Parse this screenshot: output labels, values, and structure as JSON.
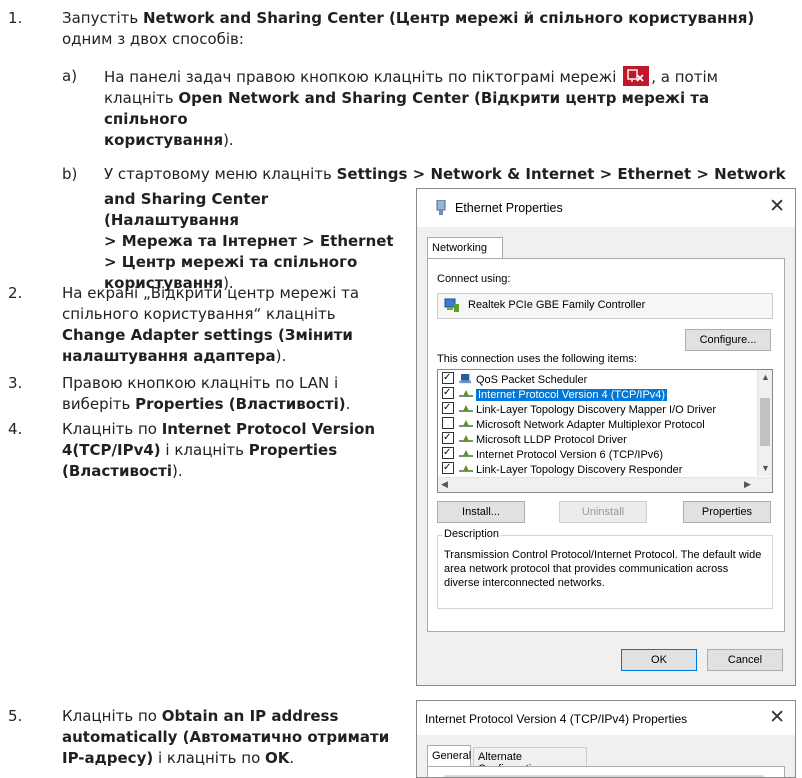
{
  "steps": [
    {
      "num": "1.",
      "pre": "Запустіть ",
      "bold": "Network and Sharing Center (Центр мережі й спільного користування)",
      "line2": "одним з двох способів:"
    },
    {
      "num": "2.",
      "l1": "На екрані „Відкрити центр мережі та",
      "l2": "спільного користування“ клацніть",
      "b1": "Change Adapter settings (Змінити",
      "b2": "налаштування адаптера",
      "end": ")."
    },
    {
      "num": "3.",
      "l1": "Правою кнопкою клацніть по LAN і",
      "pre2": "виберіть ",
      "bold": "Properties (Властивості)",
      "end": "."
    },
    {
      "num": "4.",
      "pre": "Клацніть по ",
      "b1": "Internet Protocol Version",
      "b2": "4(TCP/IPv4)",
      "mid": " і клацніть ",
      "b3": "Properties",
      "b4": "(Властивості",
      "end": ")."
    },
    {
      "num": "5.",
      "pre": "Клацніть по ",
      "b1": "Obtain an IP address",
      "b2": "automatically (Автоматично отримати",
      "b3": "IP-адресу)",
      "mid": " і клацніть по ",
      "b4": "OK",
      "end": "."
    }
  ],
  "sub_a": {
    "label": "a)",
    "l1": "На панелі задач правою кнопкою клацніть по піктограмі мережі",
    "l1_end": ", а потім",
    "l2_pre": "клацніть ",
    "l2_bold": "Open Network and Sharing Center (Відкрити центр мережі та спільного",
    "l3_bold": "користування",
    "l3_end": ")."
  },
  "sub_b": {
    "label": "b)",
    "l1_pre": "У стартовому меню клацніть ",
    "l1_bold": "Settings > Network & Internet > Ethernet > Network",
    "l2": "and Sharing Center (Налаштування",
    "l3": "> Мережа та Інтернет > Ethernet",
    "l4": "> Центр мережі та спільного",
    "l5": "користування",
    "l5_end": ")."
  },
  "dialog": {
    "title": "Ethernet Properties",
    "close": "✕",
    "tab": "Networking",
    "connect_using": "Connect using:",
    "adapter": "Realtek PCIe GBE Family Controller",
    "configure": "Configure...",
    "items_label": "This connection uses the following items:",
    "items": [
      {
        "checked": true,
        "label": "QoS Packet Scheduler",
        "selected": false
      },
      {
        "checked": true,
        "label": "Internet Protocol Version 4 (TCP/IPv4)",
        "selected": true
      },
      {
        "checked": true,
        "label": "Link-Layer Topology Discovery Mapper I/O Driver",
        "selected": false
      },
      {
        "checked": false,
        "label": "Microsoft Network Adapter Multiplexor Protocol",
        "selected": false
      },
      {
        "checked": true,
        "label": "Microsoft LLDP Protocol Driver",
        "selected": false
      },
      {
        "checked": true,
        "label": "Internet Protocol Version 6 (TCP/IPv6)",
        "selected": false
      },
      {
        "checked": true,
        "label": "Link-Layer Topology Discovery Responder",
        "selected": false
      }
    ],
    "install": "Install...",
    "uninstall": "Uninstall",
    "properties": "Properties",
    "description_label": "Description",
    "description": "Transmission Control Protocol/Internet Protocol. The default wide area network protocol that provides communication across diverse interconnected networks.",
    "ok": "OK",
    "cancel": "Cancel"
  },
  "dialog2": {
    "title": "Internet Protocol Version 4 (TCP/IPv4) Properties",
    "close": "✕",
    "tab_general": "General",
    "tab_alternate": "Alternate Configuration"
  }
}
